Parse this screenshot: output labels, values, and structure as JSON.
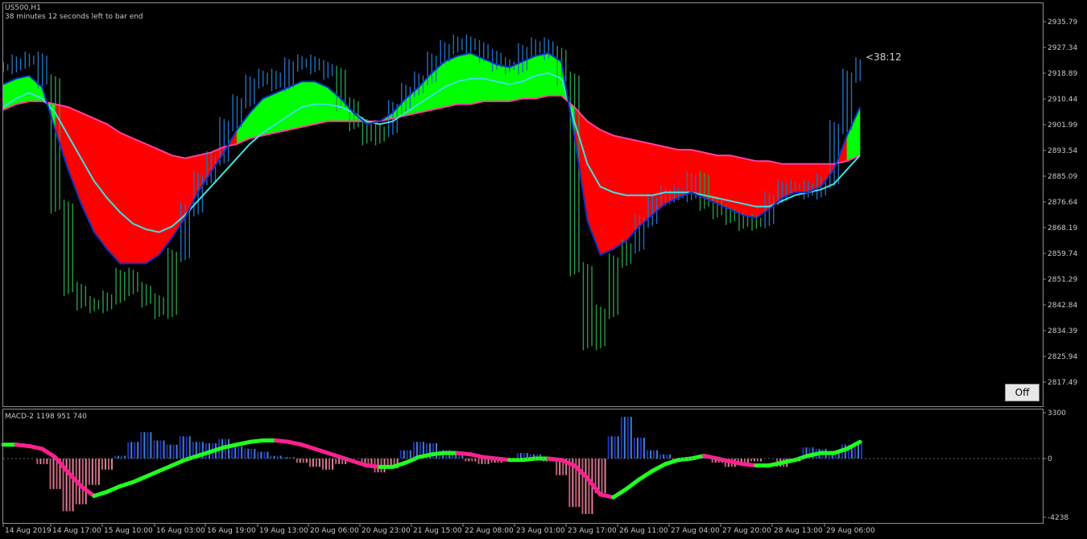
{
  "main": {
    "symbol_title": "US500,H1",
    "status_text": "38 minutes 12 seconds left to bar end",
    "countdown_label": "<38:12",
    "off_button_label": "Off"
  },
  "sub": {
    "indicator_title": "MACD-2 1198 951 740"
  },
  "colors": {
    "background": "#000000",
    "frame": "#909090",
    "bull_fill": "#00ff00",
    "bear_fill": "#ff0000",
    "ema_line": "#40e0e0",
    "slow_line": "#ff40a0",
    "fast_line": "#1030c0",
    "candle": "#2070c0",
    "hist_up": "#2030c0",
    "hist_down": "#c06070",
    "signal_up": "#20ff20",
    "signal_down": "#ff2090"
  },
  "chart_data": [
    {
      "type": "line",
      "title": "US500,H1",
      "price_ticks": [
        "2935.79",
        "2927.34",
        "2918.89",
        "2910.44",
        "2901.99",
        "2893.54",
        "2885.09",
        "2876.64",
        "2868.19",
        "2859.74",
        "2851.29",
        "2842.84",
        "2834.39",
        "2825.94",
        "2817.49"
      ],
      "time_labels": [
        "14 Aug 2019",
        "14 Aug 17:00",
        "15 Aug 10:00",
        "16 Aug 03:00",
        "16 Aug 19:00",
        "19 Aug 13:00",
        "20 Aug 06:00",
        "20 Aug 23:00",
        "21 Aug 15:00",
        "22 Aug 08:00",
        "23 Aug 01:00",
        "23 Aug 17:00",
        "26 Aug 11:00",
        "27 Aug 04:00",
        "27 Aug 20:00",
        "28 Aug 13:00",
        "29 Aug 06:00"
      ],
      "x": [
        0,
        4,
        8,
        12,
        16,
        20,
        24,
        28,
        32,
        36,
        40,
        44,
        48,
        52,
        56,
        60,
        64,
        68,
        72,
        76,
        80,
        84,
        88,
        92,
        96,
        100,
        104,
        108,
        112,
        116,
        120,
        124,
        128,
        132,
        136,
        140,
        144,
        148,
        152,
        156,
        160,
        164,
        168,
        172,
        176,
        180,
        184,
        188,
        192,
        196,
        200,
        204,
        208,
        212,
        216,
        220,
        224,
        228,
        232,
        236,
        240,
        244,
        248,
        252,
        256,
        260,
        264
      ],
      "series": [
        {
          "values": [
            2924,
            2926,
            2927,
            2919,
            2875,
            2846,
            2841,
            2840,
            2843,
            2851,
            2846,
            2842,
            2838,
            2858,
            2874,
            2885,
            2892,
            2904,
            2912,
            2919,
            2921,
            2918,
            2925,
            2926,
            2924,
            2922,
            2911,
            2904,
            2899,
            2902,
            2910,
            2916,
            2920,
            2927,
            2931,
            2933,
            2931,
            2928,
            2925,
            2924,
            2930,
            2932,
            2929,
            2920,
            2853,
            2827,
            2838,
            2856,
            2861,
            2870,
            2877,
            2880,
            2879,
            2885,
            2876,
            2873,
            2871,
            2869,
            2870,
            2878,
            2882,
            2882,
            2880,
            2884,
            2903,
            2921,
            2925
          ]
        },
        {
          "values": [
            2918,
            2920,
            2921,
            2917,
            2902,
            2888,
            2876,
            2866,
            2860,
            2855,
            2855,
            2855,
            2858,
            2864,
            2871,
            2880,
            2887,
            2894,
            2902,
            2908,
            2913,
            2915,
            2917,
            2919,
            2919,
            2917,
            2913,
            2908,
            2904,
            2905,
            2908,
            2913,
            2917,
            2922,
            2926,
            2928,
            2929,
            2927,
            2925,
            2924,
            2926,
            2928,
            2929,
            2926,
            2900,
            2870,
            2858,
            2860,
            2863,
            2868,
            2872,
            2876,
            2878,
            2880,
            2878,
            2876,
            2874,
            2872,
            2871,
            2874,
            2878,
            2880,
            2880,
            2882,
            2888,
            2900,
            2910
          ]
        },
        {
          "values": [
            2910,
            2913,
            2915,
            2913,
            2908,
            2900,
            2892,
            2884,
            2878,
            2873,
            2869,
            2867,
            2866,
            2868,
            2872,
            2877,
            2882,
            2887,
            2892,
            2897,
            2901,
            2904,
            2907,
            2910,
            2911,
            2911,
            2910,
            2908,
            2905,
            2904,
            2905,
            2908,
            2911,
            2914,
            2917,
            2919,
            2920,
            2920,
            2919,
            2918,
            2919,
            2921,
            2922,
            2920,
            2905,
            2890,
            2882,
            2880,
            2879,
            2879,
            2879,
            2880,
            2880,
            2880,
            2879,
            2878,
            2877,
            2876,
            2875,
            2875,
            2877,
            2879,
            2880,
            2881,
            2883,
            2888,
            2893
          ]
        },
        {
          "values": [
            2909,
            2911,
            2912,
            2912,
            2911,
            2910,
            2908,
            2906,
            2904,
            2901,
            2899,
            2897,
            2895,
            2893,
            2892,
            2893,
            2894,
            2896,
            2897,
            2899,
            2900,
            2901,
            2902,
            2903,
            2904,
            2905,
            2905,
            2905,
            2905,
            2905,
            2906,
            2907,
            2908,
            2909,
            2910,
            2911,
            2911,
            2912,
            2912,
            2912,
            2913,
            2913,
            2914,
            2914,
            2910,
            2905,
            2902,
            2900,
            2899,
            2898,
            2897,
            2896,
            2895,
            2895,
            2894,
            2893,
            2893,
            2892,
            2891,
            2891,
            2890,
            2890,
            2890,
            2890,
            2890,
            2891,
            2893
          ]
        }
      ],
      "ylim": [
        2813.27,
        2940.01
      ]
    },
    {
      "type": "bar",
      "title": "MACD-2 1198 951 740",
      "y_ticks": [
        "3300",
        "0",
        "-4238"
      ],
      "ylim": [
        -4238,
        3300
      ],
      "x": [
        0,
        4,
        8,
        12,
        16,
        20,
        24,
        28,
        32,
        36,
        40,
        44,
        48,
        52,
        56,
        60,
        64,
        68,
        72,
        76,
        80,
        84,
        88,
        92,
        96,
        100,
        104,
        108,
        112,
        116,
        120,
        124,
        128,
        132,
        136,
        140,
        144,
        148,
        152,
        156,
        160,
        164,
        168,
        172,
        176,
        180,
        184,
        188,
        192,
        196,
        200,
        204,
        208,
        212,
        216,
        220,
        224,
        228,
        232,
        236,
        240,
        244,
        248,
        252,
        256,
        260,
        264
      ],
      "series": [
        {
          "values": [
            0,
            0,
            0,
            -400,
            -2200,
            -3800,
            -3300,
            -1900,
            -800,
            200,
            1200,
            1900,
            1300,
            1000,
            1600,
            1200,
            1100,
            1400,
            900,
            700,
            500,
            200,
            100,
            -300,
            -600,
            -800,
            -400,
            0,
            -500,
            -1000,
            -700,
            600,
            1200,
            1100,
            600,
            300,
            -200,
            -400,
            -300,
            -100,
            400,
            300,
            -200,
            -1200,
            -3500,
            -4000,
            -2500,
            1600,
            3000,
            1500,
            600,
            300,
            -200,
            -100,
            200,
            -300,
            -600,
            -400,
            -200,
            0,
            -600,
            -200,
            800,
            700,
            400,
            1000,
            1200
          ]
        },
        {
          "values": [
            1000,
            1000,
            900,
            700,
            100,
            -1000,
            -2000,
            -2700,
            -2400,
            -2000,
            -1700,
            -1300,
            -900,
            -500,
            -100,
            200,
            500,
            800,
            1000,
            1200,
            1300,
            1300,
            1200,
            1000,
            700,
            400,
            100,
            -200,
            -500,
            -600,
            -600,
            -300,
            100,
            300,
            400,
            400,
            300,
            100,
            0,
            -100,
            -100,
            0,
            0,
            -100,
            -500,
            -1400,
            -2600,
            -2800,
            -2200,
            -1500,
            -900,
            -400,
            -100,
            0,
            200,
            0,
            -200,
            -400,
            -500,
            -500,
            -300,
            -100,
            200,
            400,
            400,
            700,
            1200
          ]
        }
      ]
    }
  ]
}
